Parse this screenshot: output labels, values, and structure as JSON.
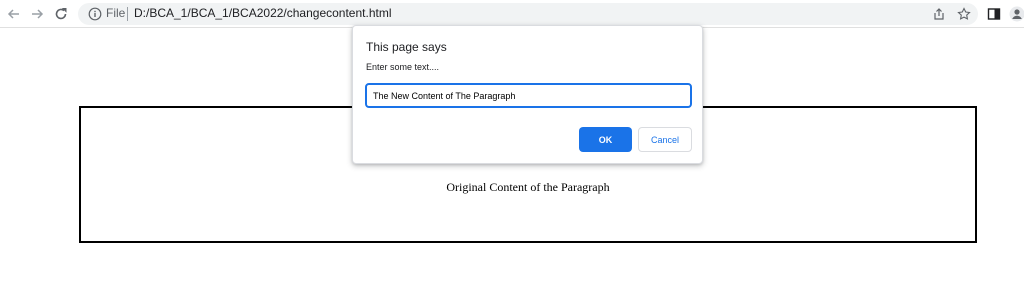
{
  "toolbar": {
    "back_icon": "arrow-left-icon",
    "forward_icon": "arrow-right-icon",
    "reload_icon": "reload-icon",
    "info_icon": "info-circle-icon",
    "file_label": "File",
    "url": "D:/BCA_1/BCA_1/BCA2022/changecontent.html",
    "right_icons": [
      "share-icon",
      "star-icon",
      "side-panel-icon",
      "profile-icon"
    ]
  },
  "page": {
    "paragraph_text": "Original Content of the Paragraph"
  },
  "dialog": {
    "title": "This page says",
    "message": "Enter some text....",
    "input_value": "The New Content of The Paragraph",
    "ok_label": "OK",
    "cancel_label": "Cancel"
  },
  "colors": {
    "accent": "#1a73e8",
    "omnibox_bg": "#f1f3f4",
    "box_border": "#000000"
  }
}
